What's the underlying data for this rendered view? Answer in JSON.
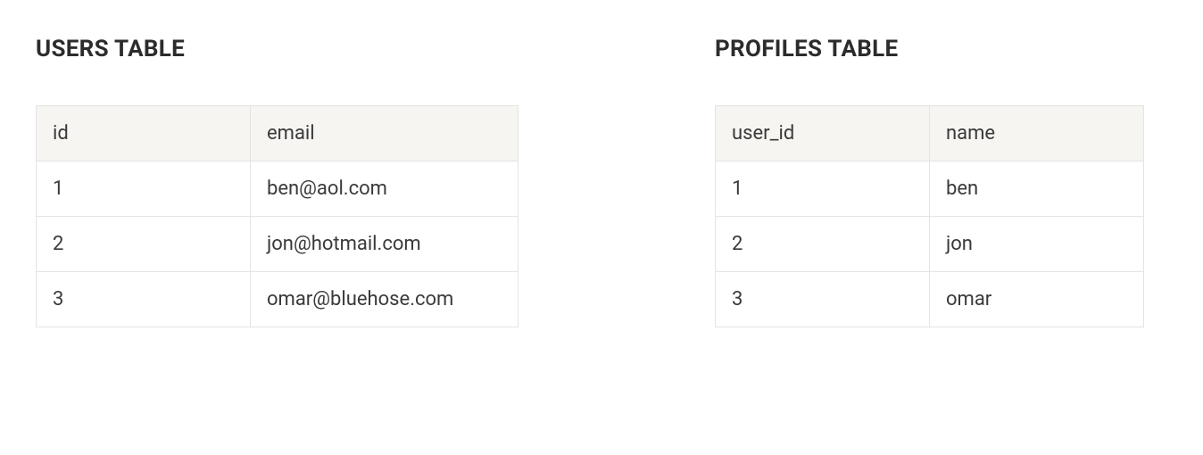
{
  "users": {
    "title": "USERS TABLE",
    "headers": [
      "id",
      "email"
    ],
    "rows": [
      [
        "1",
        "ben@aol.com"
      ],
      [
        "2",
        "jon@hotmail.com"
      ],
      [
        "3",
        "omar@bluehose.com"
      ]
    ]
  },
  "profiles": {
    "title": "PROFILES TABLE",
    "headers": [
      "user_id",
      "name"
    ],
    "rows": [
      [
        "1",
        "ben"
      ],
      [
        "2",
        "jon"
      ],
      [
        "3",
        "omar"
      ]
    ]
  }
}
